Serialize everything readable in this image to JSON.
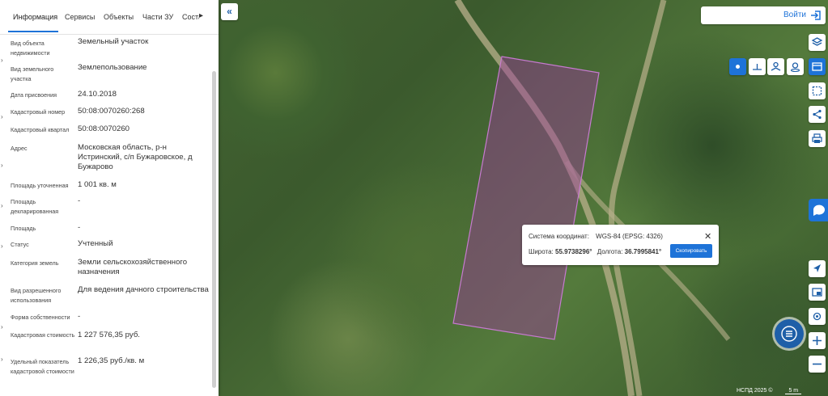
{
  "panel": {
    "tabs": [
      {
        "label": "Информация"
      },
      {
        "label": "Сервисы"
      },
      {
        "label": "Объекты"
      },
      {
        "label": "Части ЗУ"
      },
      {
        "label": "Соста"
      }
    ],
    "rows": [
      {
        "label": "Вид объекта недвижимости",
        "value": "Земельный участок"
      },
      {
        "label": "Вид земельного участка",
        "value": "Землепользование"
      },
      {
        "label": "Дата присвоения",
        "value": "24.10.2018"
      },
      {
        "label": "Кадастровый номер",
        "value": "50:08:0070260:268"
      },
      {
        "label": "Кадастровый квартал",
        "value": "50:08:0070260"
      },
      {
        "label": "Адрес",
        "value": "Московская область, р-н Истринский, с/п Бужаровское, д Бужарово"
      },
      {
        "label": "Площадь уточненная",
        "value": "1 001 кв. м"
      },
      {
        "label": "Площадь декларированная",
        "value": "-"
      },
      {
        "label": "Площадь",
        "value": "-"
      },
      {
        "label": "Статус",
        "value": "Учтенный"
      },
      {
        "label": "Категория земель",
        "value": "Земли сельскохозяйственного назначения"
      },
      {
        "label": "Вид разрешенного использования",
        "value": "Для ведения дачного строительства"
      },
      {
        "label": "Форма собственности",
        "value": "-"
      },
      {
        "label": "Кадастровая стоимость",
        "value": "1 227 576,35 руб."
      },
      {
        "label": "Удельный показатель кадастровой стоимости",
        "value": "1 226,35 руб./кв. м"
      }
    ]
  },
  "header": {
    "login_label": "Войти"
  },
  "popup": {
    "system_label": "Система координат:",
    "system_value": "WGS-84 (EPSG: 4326)",
    "lat_label": "Широта:",
    "lat_value": "55.9738296°",
    "lon_label": "Долгота:",
    "lon_value": "36.7995841°",
    "copy_label": "Скопировать"
  },
  "map": {
    "scale_text": "НСПД 2025 ©",
    "scale_value": "5 m"
  },
  "colors": {
    "accent": "#1e73d8",
    "parcel_fill": "#9b3a9c",
    "parcel_stroke": "#c77ad0"
  }
}
